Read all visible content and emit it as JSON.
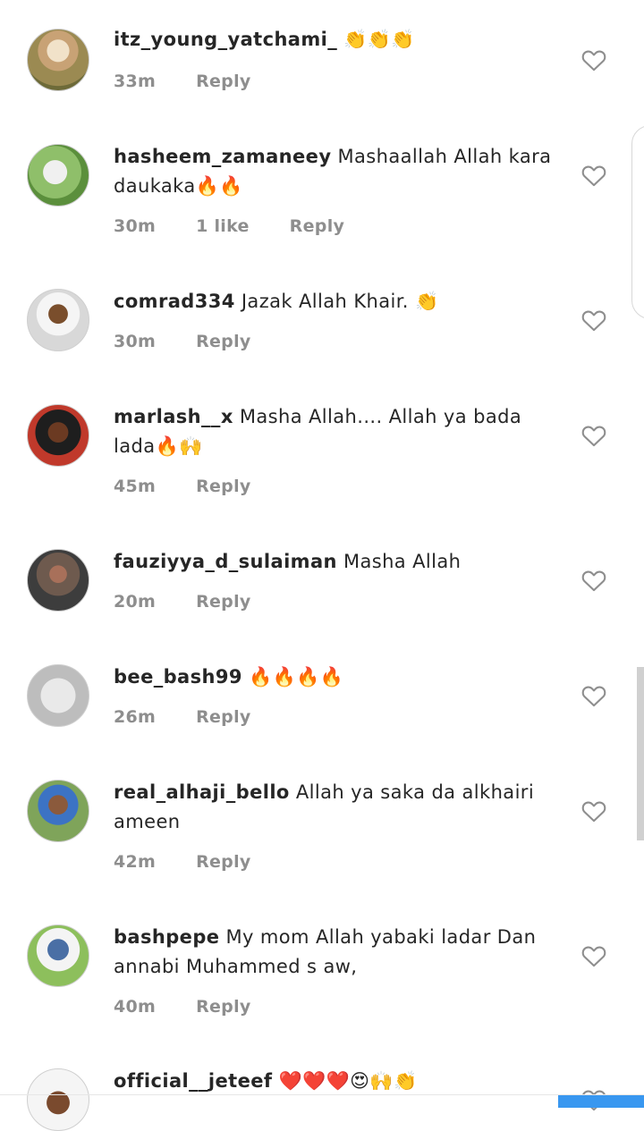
{
  "comments": [
    {
      "user": "itz_young_yatchami_",
      "text": "👏👏👏",
      "time": "33m",
      "likes": "",
      "reply": "Reply"
    },
    {
      "user": "hasheem_zamaneey",
      "text": "Mashaallah Allah kara daukaka🔥🔥",
      "time": "30m",
      "likes": "1 like",
      "reply": "Reply"
    },
    {
      "user": "comrad334",
      "text": "Jazak Allah Khair. 👏",
      "time": "30m",
      "likes": "",
      "reply": "Reply"
    },
    {
      "user": "marlash__x",
      "text": "Masha Allah.... Allah ya bada lada🔥🙌",
      "time": "45m",
      "likes": "",
      "reply": "Reply"
    },
    {
      "user": "fauziyya_d_sulaiman",
      "text": "Masha Allah",
      "time": "20m",
      "likes": "",
      "reply": "Reply"
    },
    {
      "user": "bee_bash99",
      "text": "🔥🔥🔥🔥",
      "time": "26m",
      "likes": "",
      "reply": "Reply"
    },
    {
      "user": "real_alhaji_bello",
      "text": "Allah ya saka da alkhairi ameen",
      "time": "42m",
      "likes": "",
      "reply": "Reply"
    },
    {
      "user": "bashpepe",
      "text": "My mom Allah yabaki ladar Dan annabi Muhammed s aw,",
      "time": "40m",
      "likes": "",
      "reply": "Reply"
    },
    {
      "user": "official__jeteef",
      "text": "❤️❤️❤️😍🙌👏",
      "time": "",
      "likes": "",
      "reply": ""
    }
  ],
  "colors": {
    "text": "#262626",
    "meta": "#8e8e8e",
    "accent": "#3897f0"
  },
  "icons": {
    "like": "heart-outline-icon"
  }
}
